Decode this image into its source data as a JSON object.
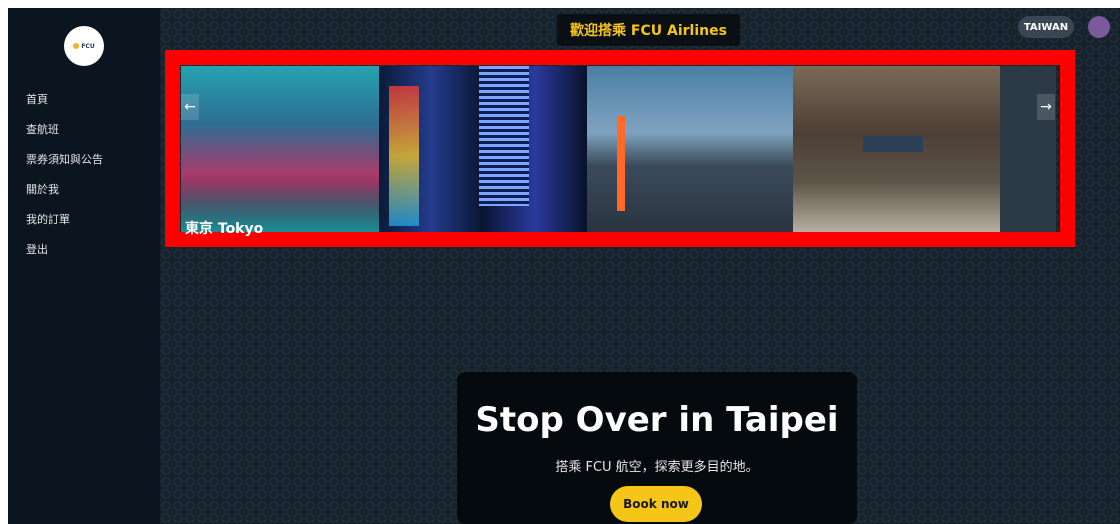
{
  "header": {
    "welcome_text": "歡迎搭乘 FCU Airlines",
    "region_label": "TAIWAN"
  },
  "sidebar": {
    "logo_text": "FCU",
    "items": [
      {
        "label": "首頁"
      },
      {
        "label": "查航班"
      },
      {
        "label": "票券須知與公告"
      },
      {
        "label": "關於我"
      },
      {
        "label": "我的訂單"
      },
      {
        "label": "登出"
      }
    ]
  },
  "carousel": {
    "caption": "東京 Tokyo",
    "prev_icon": "arrow-left",
    "next_icon": "arrow-right",
    "highlight_color": "#ff0000"
  },
  "promo": {
    "title": "Stop Over in Taipei",
    "subtitle": "搭乘 FCU 航空，探索更多目的地。",
    "button_label": "Book now",
    "accent_color": "#f5c518"
  }
}
